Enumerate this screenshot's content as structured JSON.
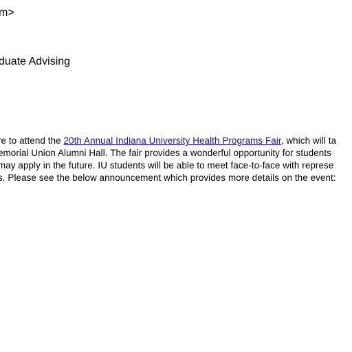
{
  "header": {
    "from_fragment": "m>",
    "subject_fragment": "duate Advising"
  },
  "body": {
    "line1_before": "re to attend the ",
    "fair_link": "20th Annual Indiana University Health Programs Fair",
    "line1_after": ", which will ta",
    "line2": "emorial Union Alumni Hall.  The fair provides a wonderful opportunity for students",
    "line3": "may apply in the future. IU students will be able to meet face-to-face with represe",
    "line4": "s.  Please see the below announcement which provides more details on the event:"
  },
  "colors": {
    "link": "#1a0dab",
    "text": "#000000",
    "background": "#ffffff"
  }
}
